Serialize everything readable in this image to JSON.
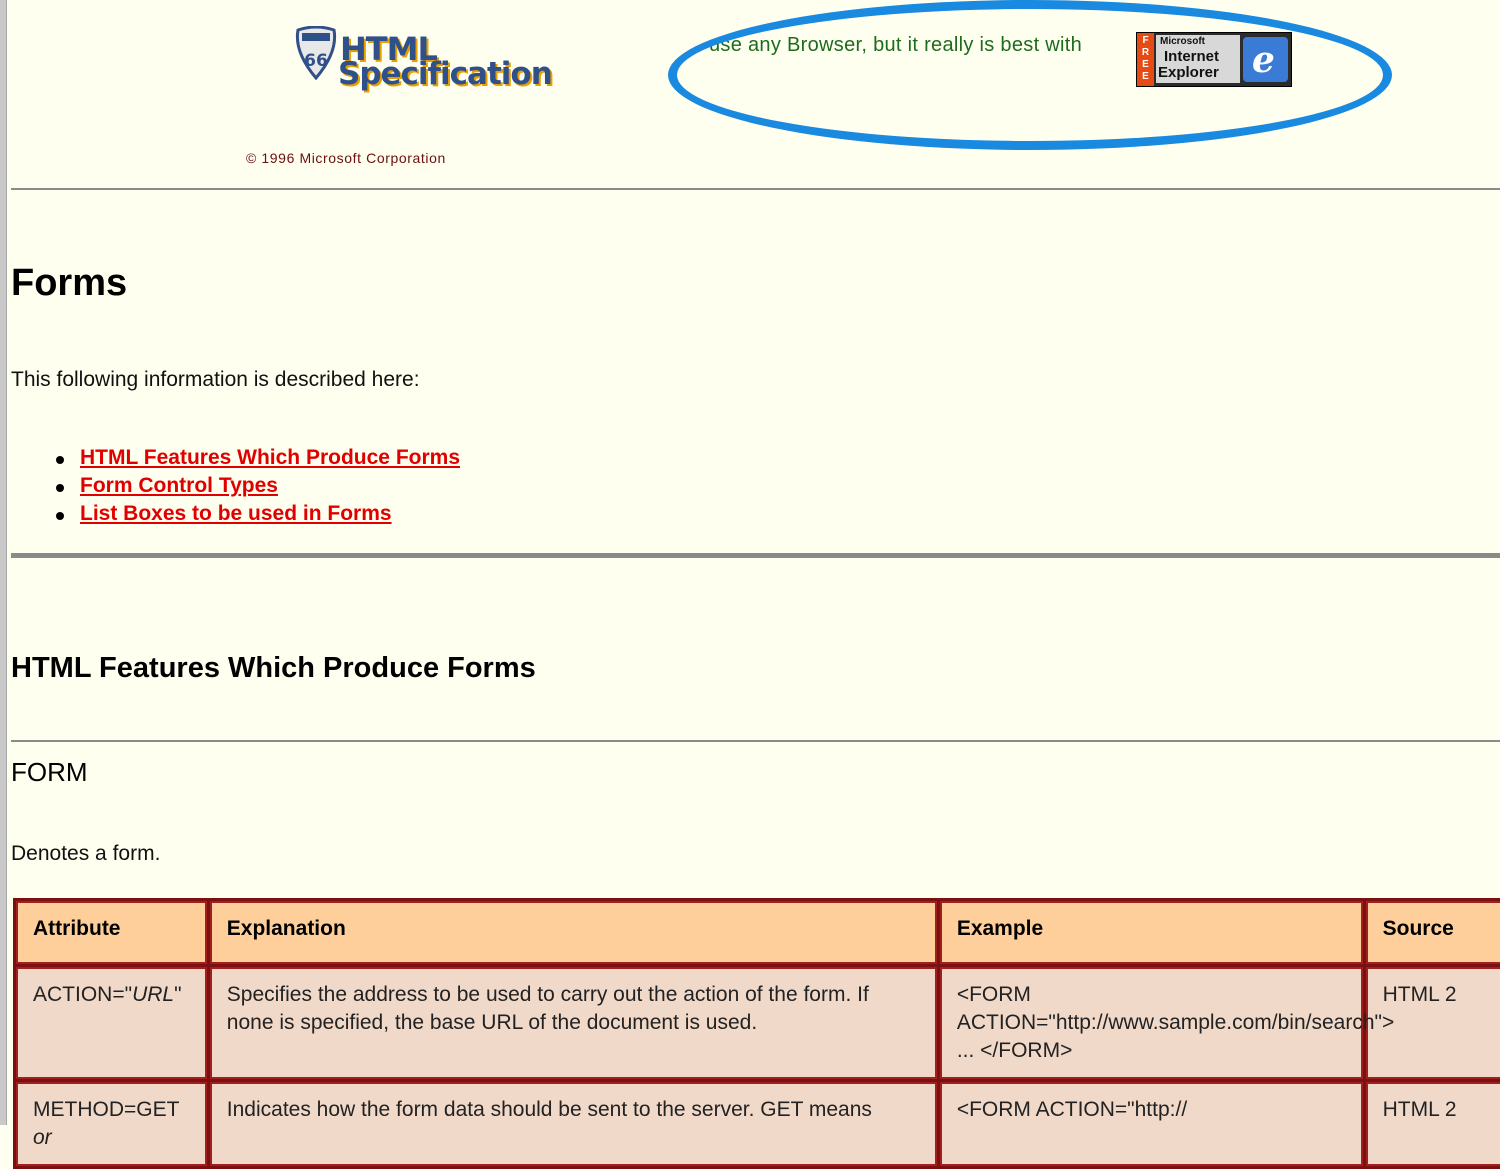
{
  "header": {
    "logo_html": "HTML",
    "logo_spec": "Specification",
    "logo_shield_number": "66",
    "copyright": "© 1996 Microsoft Corporation",
    "promo_text": "use any Browser, but it really is best with",
    "badge": {
      "free": "FREE",
      "line1": "Microsoft",
      "line2": "Internet",
      "line3": "Explorer",
      "logo_letter": "e"
    }
  },
  "page": {
    "title": "Forms",
    "intro": "This following information is described here:",
    "toc": [
      "HTML Features Which Produce Forms",
      "Form Control Types",
      "List Boxes to be used in Forms"
    ],
    "section_title": "HTML Features Which Produce Forms",
    "subsection_title": "FORM",
    "subsection_desc": "Denotes a form."
  },
  "table": {
    "headers": [
      "Attribute",
      "Explanation",
      "Example",
      "Source"
    ],
    "rows": [
      {
        "attribute_prefix": "ACTION=\"",
        "attribute_italic": "URL",
        "attribute_suffix": "\"",
        "explanation": "Specifies the address to be used to carry out the action of the form. If none is specified, the base URL of the document is used.",
        "example": "<FORM ACTION=\"http://www.sample.com/bin/search\"> ... </FORM>",
        "source": "HTML 2"
      },
      {
        "attribute_prefix": "METHOD=GET ",
        "attribute_italic": "or",
        "attribute_suffix": "",
        "explanation": "Indicates how the form data should be sent to the server. GET means",
        "example": "<FORM ACTION=\"http://",
        "source": "HTML 2"
      }
    ]
  },
  "colors": {
    "background": "#fffff0",
    "link": "#e00000",
    "highlight_ring": "#1a8ae0",
    "table_header": "#fecf9a",
    "table_cell": "#f1d9c9",
    "table_border": "#7a1010"
  }
}
